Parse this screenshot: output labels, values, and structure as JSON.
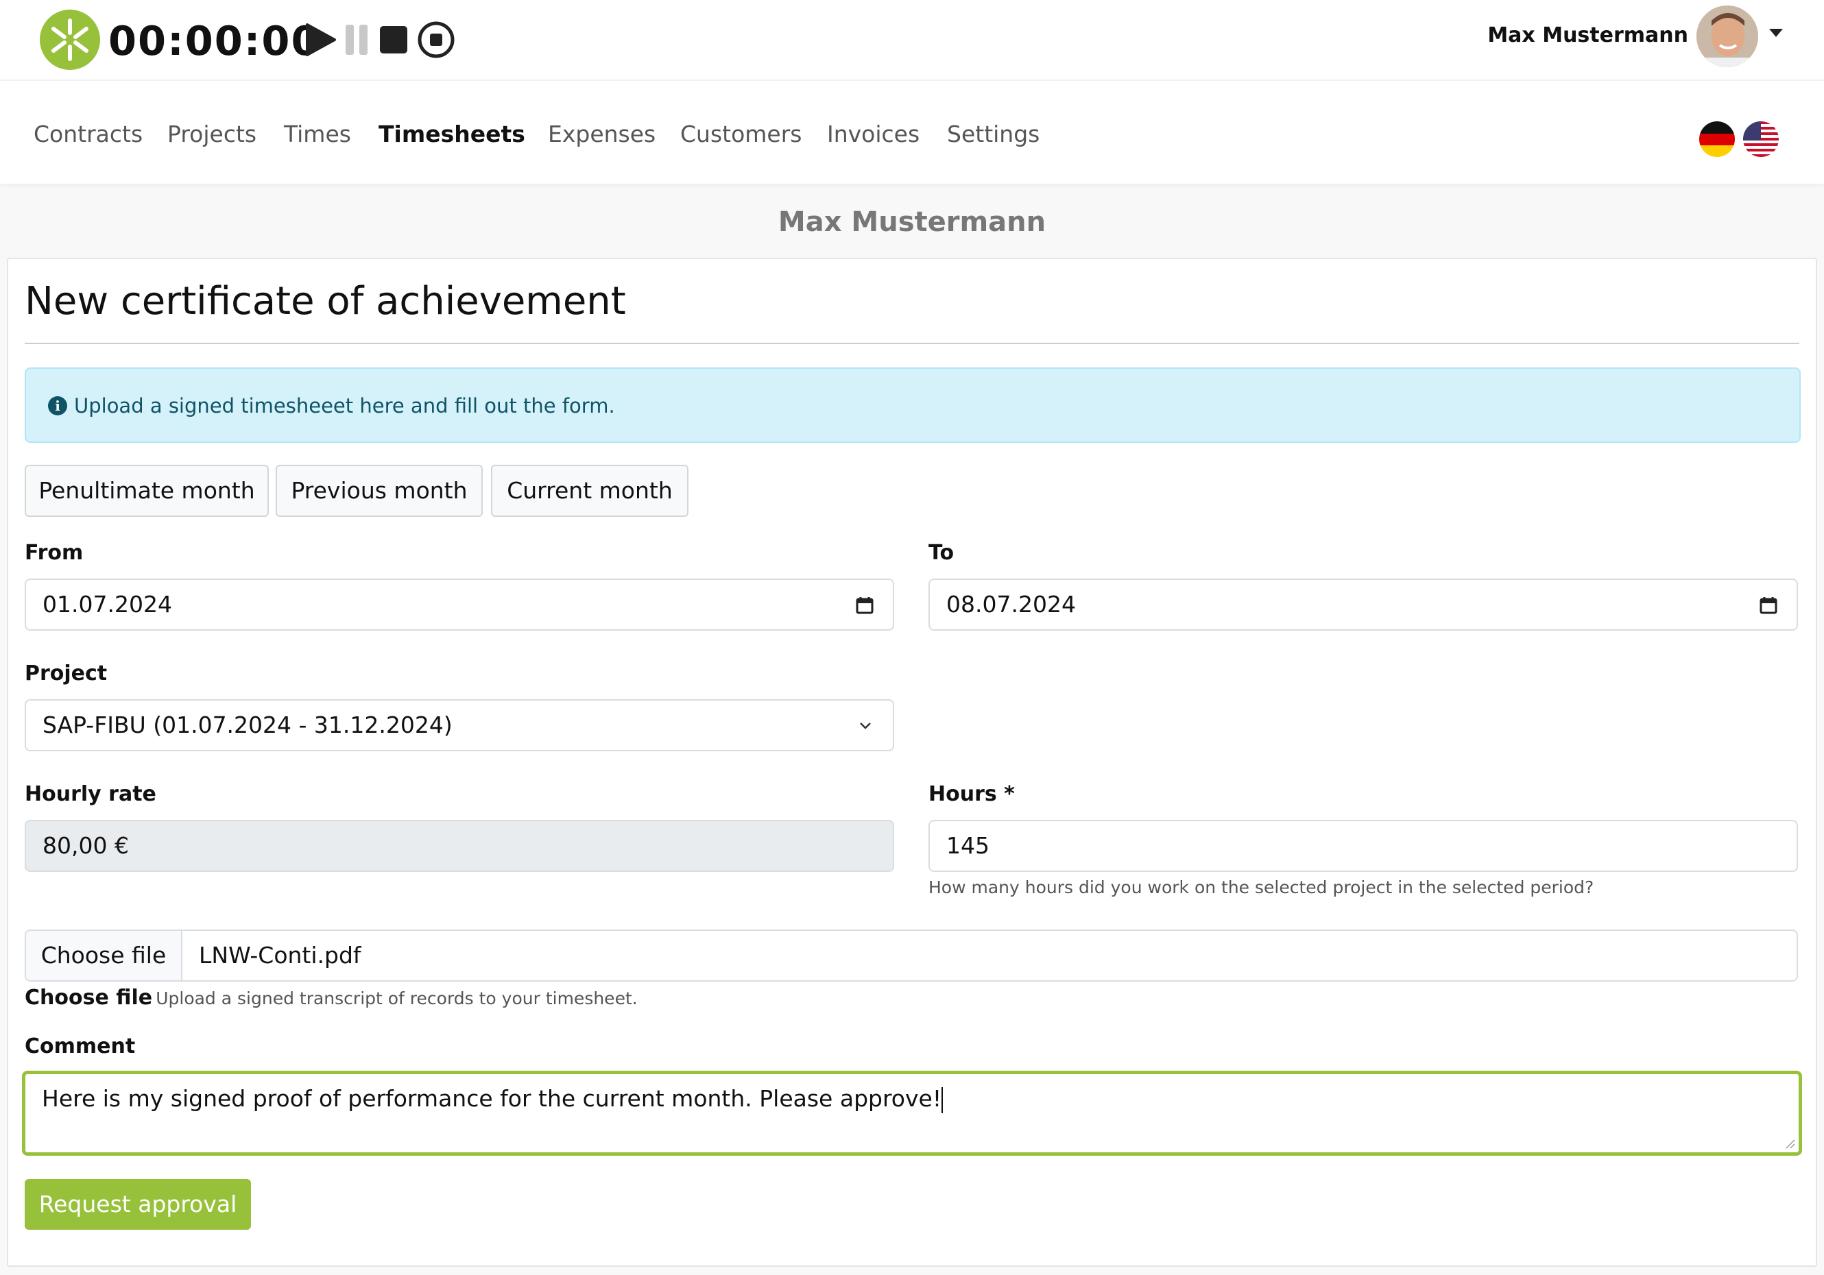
{
  "header": {
    "timer": "00:00:00",
    "user_name": "Max Mustermann"
  },
  "nav": {
    "items": [
      {
        "label": "Contracts"
      },
      {
        "label": "Projects"
      },
      {
        "label": "Times"
      },
      {
        "label": "Timesheets",
        "active": true
      },
      {
        "label": "Expenses"
      },
      {
        "label": "Customers"
      },
      {
        "label": "Invoices"
      },
      {
        "label": "Settings"
      }
    ]
  },
  "page": {
    "user_heading": "Max Mustermann",
    "title": "New certificate of achievement",
    "alert": "Upload a signed timesheeet here and fill out the form."
  },
  "month_buttons": {
    "penultimate": "Penultimate month",
    "previous": "Previous month",
    "current": "Current month"
  },
  "form": {
    "from_label": "From",
    "from_value": "01.07.2024",
    "to_label": "To",
    "to_value": "08.07.2024",
    "project_label": "Project",
    "project_value": "SAP-FIBU (01.07.2024 - 31.12.2024)",
    "rate_label": "Hourly rate",
    "rate_value": "80,00 €",
    "hours_label": "Hours *",
    "hours_value": "145",
    "hours_help": "How many hours did you work on the selected project in the selected period?",
    "file_button": "Choose file",
    "file_name": "LNW-Conti.pdf",
    "file_help_bold": "Choose file",
    "file_help": "Upload a signed transcript of records to your timesheet.",
    "comment_label": "Comment",
    "comment_value": "Here is my signed proof of performance for the current month. Please approve!",
    "submit": "Request approval"
  },
  "colors": {
    "accent": "#97c13b",
    "alert_bg": "#d5f2fa",
    "alert_text": "#0f5366"
  }
}
